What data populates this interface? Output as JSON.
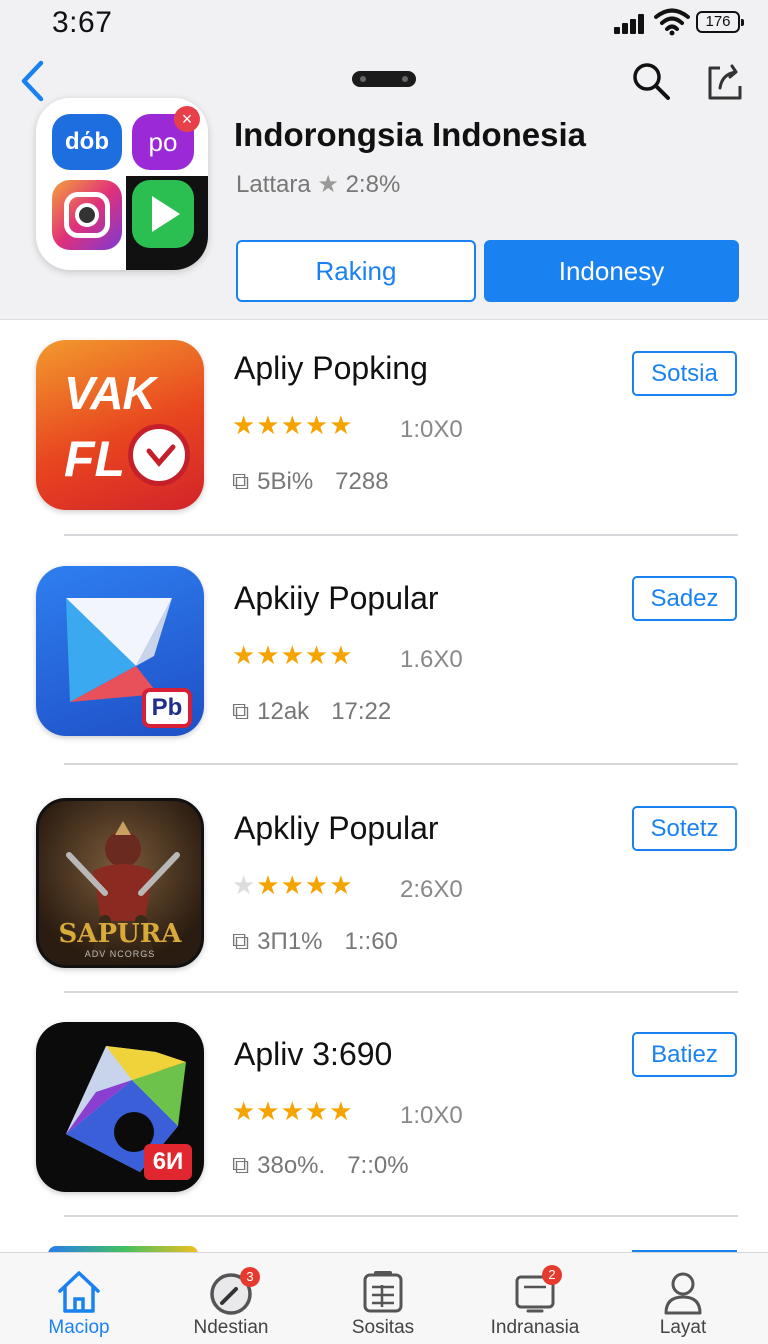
{
  "status_bar": {
    "time": "3:67",
    "battery": "176"
  },
  "header": {
    "title": "Indorongsia Indonesia",
    "subtitle_label": "Lattara",
    "subtitle_star": "★",
    "subtitle_value": "2:8%",
    "ranking_button": "Raking",
    "indonesy_button": "Indonesy",
    "hero_tiles": {
      "top_left": "dόb",
      "top_right": "po"
    }
  },
  "apps": [
    {
      "name": "Apliy Popking",
      "rating": 4.5,
      "rating_count": "1:0X0",
      "size": "5Bi%",
      "time": "7288",
      "button": "Sotsia",
      "icon_text_1": "VAK",
      "icon_text_2": "FL"
    },
    {
      "name": "Apkiiy Popular",
      "rating": 4.5,
      "rating_count": "1.6X0",
      "size": "12ak",
      "time": "17:22",
      "button": "Sadez",
      "icon_badge": "Pb"
    },
    {
      "name": "Apkliy Popular",
      "rating": 4,
      "rating_count": "2:6X0",
      "size": "3Π1%",
      "time": "1::60",
      "button": "Sotetz",
      "icon_title": "SAPURA",
      "icon_caption": "ADV NCORGS"
    },
    {
      "name": "Apliv 3:690",
      "rating": 4.5,
      "rating_count": "1:0X0",
      "size": "38o%.",
      "time": "7::0%",
      "button": "Batiez",
      "icon_badge": "6И"
    }
  ],
  "tabbar": {
    "items": [
      {
        "label": "Maciop",
        "icon": "home-icon",
        "badge": ""
      },
      {
        "label": "Ndestian",
        "icon": "compass-icon",
        "badge": "3"
      },
      {
        "label": "Sositas",
        "icon": "document-icon",
        "badge": ""
      },
      {
        "label": "Indranasia",
        "icon": "tablet-icon",
        "badge": "2"
      },
      {
        "label": "Layat",
        "icon": "person-icon",
        "badge": ""
      }
    ]
  },
  "colors": {
    "accent": "#1a82f0",
    "star": "#f5a300",
    "badge": "#e63a2e"
  }
}
